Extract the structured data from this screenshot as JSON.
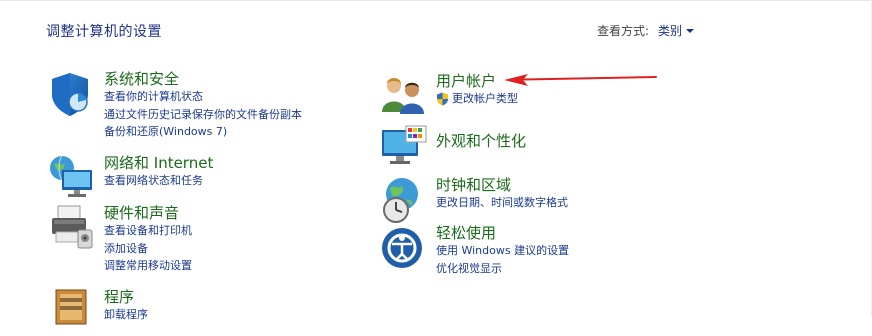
{
  "header": {
    "title": "调整计算机的设置",
    "view_by_label": "查看方式:",
    "view_by_value": "类别"
  },
  "categories_left": [
    {
      "title": "系统和安全",
      "icon": "shield-system-icon",
      "links": [
        "查看你的计算机状态",
        "通过文件历史记录保存你的文件备份副本",
        "备份和还原(Windows 7)"
      ]
    },
    {
      "title": "网络和 Internet",
      "icon": "network-globe-icon",
      "links": [
        "查看网络状态和任务"
      ]
    },
    {
      "title": "硬件和声音",
      "icon": "printer-hardware-icon",
      "links": [
        "查看设备和打印机",
        "添加设备",
        "调整常用移动设置"
      ]
    },
    {
      "title": "程序",
      "icon": "programs-icon",
      "links": [
        "卸载程序"
      ]
    }
  ],
  "categories_right": [
    {
      "title": "用户帐户",
      "icon": "users-icon",
      "links": [
        "更改帐户类型"
      ]
    },
    {
      "title": "外观和个性化",
      "icon": "monitor-palette-icon",
      "links": []
    },
    {
      "title": "时钟和区域",
      "icon": "clock-globe-icon",
      "links": [
        "更改日期、时间或数字格式"
      ]
    },
    {
      "title": "轻松使用",
      "icon": "ease-of-access-icon",
      "links": [
        "使用 Windows 建议的设置",
        "优化视觉显示"
      ]
    }
  ],
  "annotation": {
    "icon": "red-arrow-icon",
    "color": "#e02020"
  }
}
